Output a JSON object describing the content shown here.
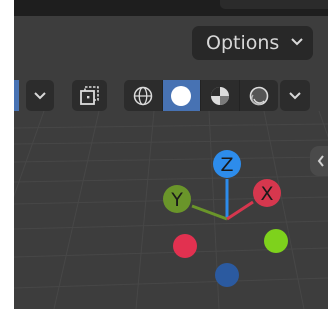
{
  "header": {
    "options_label": "Options"
  },
  "icons": {
    "options_dropdown": "chevron-down-icon",
    "mode_dropdown": "chevron-down-icon",
    "overlay_toggle": "xray-toggle-icon",
    "wireframe": "wireframe-shading-icon",
    "solid": "solid-shading-icon",
    "material": "material-preview-shading-icon",
    "rendered": "rendered-shading-icon",
    "shading_dropdown": "chevron-down-icon",
    "sidebar_toggle": "chevron-left-icon"
  },
  "shading": {
    "active": "solid"
  },
  "gizmo": {
    "z_label": "Z",
    "y_label": "Y",
    "x_label": "X",
    "colors": {
      "x": "#d6374e",
      "y": "#6a952a",
      "z": "#2d8ceb",
      "x_neg": "#e23150",
      "y_neg": "#7ed21c",
      "z_neg": "#2b5aa0"
    }
  },
  "colors": {
    "viewport_bg": "#3d3d3d",
    "header_button": "#2c2c2c",
    "accent": "#4772b3"
  }
}
